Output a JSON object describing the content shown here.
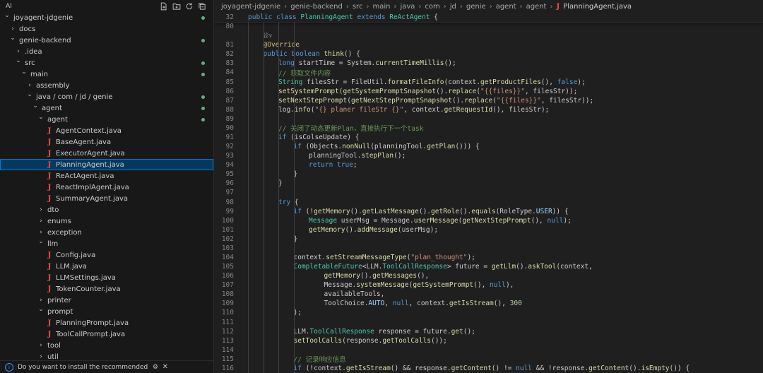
{
  "sidebar": {
    "header": "AI",
    "tree": [
      {
        "label": "joyagent-jdgenie",
        "depth": 0,
        "type": "folder",
        "open": true,
        "dot": true
      },
      {
        "label": "docs",
        "depth": 1,
        "type": "folder",
        "open": false
      },
      {
        "label": "genie-backend",
        "depth": 1,
        "type": "folder",
        "open": true,
        "dot": true
      },
      {
        "label": ".idea",
        "depth": 2,
        "type": "folder",
        "open": false
      },
      {
        "label": "src",
        "depth": 2,
        "type": "folder",
        "open": true,
        "dot": true
      },
      {
        "label": "main",
        "depth": 3,
        "type": "folder",
        "open": true,
        "dot": true
      },
      {
        "label": "assembly",
        "depth": 4,
        "type": "folder",
        "open": false
      },
      {
        "label": "java / com / jd / genie",
        "depth": 4,
        "type": "folder",
        "open": true,
        "dot": true
      },
      {
        "label": "agent",
        "depth": 5,
        "type": "folder",
        "open": true,
        "dot": true
      },
      {
        "label": "agent",
        "depth": 6,
        "type": "folder",
        "open": true,
        "dot": true
      },
      {
        "label": "AgentContext.java",
        "depth": 7,
        "type": "java"
      },
      {
        "label": "BaseAgent.java",
        "depth": 7,
        "type": "java"
      },
      {
        "label": "ExecutorAgent.java",
        "depth": 7,
        "type": "java"
      },
      {
        "label": "PlanningAgent.java",
        "depth": 7,
        "type": "java",
        "selected": true
      },
      {
        "label": "ReActAgent.java",
        "depth": 7,
        "type": "java"
      },
      {
        "label": "ReactImplAgent.java",
        "depth": 7,
        "type": "java"
      },
      {
        "label": "SummaryAgent.java",
        "depth": 7,
        "type": "java"
      },
      {
        "label": "dto",
        "depth": 6,
        "type": "folder",
        "open": false
      },
      {
        "label": "enums",
        "depth": 6,
        "type": "folder",
        "open": false
      },
      {
        "label": "exception",
        "depth": 6,
        "type": "folder",
        "open": false
      },
      {
        "label": "llm",
        "depth": 6,
        "type": "folder",
        "open": true
      },
      {
        "label": "Config.java",
        "depth": 7,
        "type": "java"
      },
      {
        "label": "LLM.java",
        "depth": 7,
        "type": "java"
      },
      {
        "label": "LLMSettings.java",
        "depth": 7,
        "type": "java"
      },
      {
        "label": "TokenCounter.java",
        "depth": 7,
        "type": "java"
      },
      {
        "label": "printer",
        "depth": 6,
        "type": "folder",
        "open": false
      },
      {
        "label": "prompt",
        "depth": 6,
        "type": "folder",
        "open": true
      },
      {
        "label": "PlanningPrompt.java",
        "depth": 7,
        "type": "java"
      },
      {
        "label": "ToolCallPrompt.java",
        "depth": 7,
        "type": "java"
      },
      {
        "label": "tool",
        "depth": 6,
        "type": "folder",
        "open": false
      },
      {
        "label": "util",
        "depth": 6,
        "type": "folder",
        "open": false
      }
    ],
    "notification": "Do you want to install the recommended"
  },
  "editor": {
    "breadcrumb": [
      "joyagent-jdgenie",
      "genie-backend",
      "src",
      "main",
      "java",
      "com",
      "jd",
      "genie",
      "agent",
      "agent"
    ],
    "file": "PlanningAgent.java",
    "sticky": {
      "num": "32",
      "html": "<span class=\"kw\">public class</span> <span class=\"cls\">PlanningAgent</span> <span class=\"kw\">extends</span> <span class=\"cls\">ReActAgent</span> {"
    },
    "lines": [
      {
        "num": "80",
        "ind": 0,
        "html": ""
      },
      {
        "num": "",
        "ind": 1,
        "html": "<span style=\"color:#8a8a8a;font-size:8px\">诊∨</span>"
      },
      {
        "num": "81",
        "ind": 1,
        "html": "<span class=\"ann\">@Override</span>"
      },
      {
        "num": "82",
        "ind": 1,
        "html": "<span class=\"kw\">public boolean</span> <span class=\"fn\">think</span>() {"
      },
      {
        "num": "83",
        "ind": 2,
        "html": "<span class=\"kw\">long</span> startTime = System.<span class=\"fn\">currentTimeMillis</span>();"
      },
      {
        "num": "84",
        "ind": 2,
        "html": "<span class=\"cmt\">// 获取文件内容</span>"
      },
      {
        "num": "85",
        "ind": 2,
        "html": "<span class=\"cls\">String</span> filesStr = FileUtil.<span class=\"fn\">formatFileInfo</span>(context.<span class=\"fn\">getProductFiles</span>(), <span class=\"kw\">false</span>);"
      },
      {
        "num": "86",
        "ind": 2,
        "html": "<span class=\"fn\">setSystemPrompt</span>(<span class=\"fn\">getSystemPromptSnapshot</span>().<span class=\"fn\">replace</span>(<span class=\"str\">\"{{files}}\"</span>, filesStr));"
      },
      {
        "num": "87",
        "ind": 2,
        "html": "<span class=\"fn\">setNextStepPrompt</span>(<span class=\"fn\">getNextStepPromptSnapshot</span>().<span class=\"fn\">replace</span>(<span class=\"str\">\"{{files}}\"</span>, filesStr));"
      },
      {
        "num": "88",
        "ind": 2,
        "html": "log.<span class=\"fn\">info</span>(<span class=\"str\">\"{} planer fileStr {}\"</span>, context.<span class=\"fn\">getRequestId</span>(), filesStr);"
      },
      {
        "num": "89",
        "ind": 0,
        "html": ""
      },
      {
        "num": "90",
        "ind": 2,
        "html": "<span class=\"cmt\">// 关闭了动态更新Plan，直接执行下一个task</span>"
      },
      {
        "num": "91",
        "ind": 2,
        "html": "<span class=\"kw\">if</span> (isColseUpdate) {"
      },
      {
        "num": "92",
        "ind": 3,
        "html": "<span class=\"kw\">if</span> (Objects.<span class=\"fn\">nonNull</span>(planningTool.<span class=\"fn\">getPlan</span>())) {"
      },
      {
        "num": "93",
        "ind": 4,
        "html": "planningTool.<span class=\"fn\">stepPlan</span>();"
      },
      {
        "num": "94",
        "ind": 4,
        "html": "<span class=\"kw\">return true</span>;"
      },
      {
        "num": "95",
        "ind": 3,
        "html": "}"
      },
      {
        "num": "96",
        "ind": 2,
        "html": "}"
      },
      {
        "num": "97",
        "ind": 0,
        "html": ""
      },
      {
        "num": "98",
        "ind": 2,
        "html": "<span class=\"kw\">try</span> {"
      },
      {
        "num": "99",
        "ind": 3,
        "html": "<span class=\"kw\">if</span> (!<span class=\"fn\">getMemory</span>().<span class=\"fn\">getLastMessage</span>().<span class=\"fn\">getRole</span>().<span class=\"fn\">equals</span>(RoleType.<span class=\"var\">USER</span>)) {"
      },
      {
        "num": "100",
        "ind": 4,
        "html": "<span class=\"cls\">Message</span> userMsg = Message.<span class=\"fn\">userMessage</span>(<span class=\"fn\">getNextStepPrompt</span>(), <span class=\"kw\">null</span>);"
      },
      {
        "num": "101",
        "ind": 4,
        "html": "<span class=\"fn\">getMemory</span>().<span class=\"fn\">addMessage</span>(userMsg);"
      },
      {
        "num": "102",
        "ind": 3,
        "html": "}"
      },
      {
        "num": "103",
        "ind": 0,
        "html": ""
      },
      {
        "num": "104",
        "ind": 3,
        "html": "context.<span class=\"fn\">setStreamMessageType</span>(<span class=\"str\">\"plan_thought\"</span>);"
      },
      {
        "num": "105",
        "ind": 3,
        "html": "<span class=\"cls\">CompletableFuture</span>&lt;LLM.<span class=\"cls\">ToolCallResponse</span>&gt; future = <span class=\"fn\">getLlm</span>().<span class=\"fn\">askTool</span>(context,"
      },
      {
        "num": "106",
        "ind": 5,
        "html": "<span class=\"fn\">getMemory</span>().<span class=\"fn\">getMessages</span>(),"
      },
      {
        "num": "107",
        "ind": 5,
        "html": "Message.<span class=\"fn\">systemMessage</span>(<span class=\"fn\">getSystemPrompt</span>(), <span class=\"kw\">null</span>),"
      },
      {
        "num": "108",
        "ind": 5,
        "html": "availableTools,"
      },
      {
        "num": "109",
        "ind": 5,
        "html": "ToolChoice.<span class=\"var\">AUTO</span>, <span class=\"kw\">null</span>, context.<span class=\"fn\">getIsStream</span>(), <span class=\"num\">300</span>"
      },
      {
        "num": "110",
        "ind": 3,
        "html": ");"
      },
      {
        "num": "111",
        "ind": 0,
        "html": ""
      },
      {
        "num": "112",
        "ind": 3,
        "html": "LLM.<span class=\"cls\">ToolCallResponse</span> response = future.<span class=\"fn\">get</span>();"
      },
      {
        "num": "113",
        "ind": 3,
        "html": "<span class=\"fn\">setToolCalls</span>(response.<span class=\"fn\">getToolCalls</span>());"
      },
      {
        "num": "114",
        "ind": 0,
        "html": ""
      },
      {
        "num": "115",
        "ind": 3,
        "html": "<span class=\"cmt\">// 记录响应信息</span>"
      },
      {
        "num": "116",
        "ind": 3,
        "html": "<span class=\"kw\">if</span> (!context.<span class=\"fn\">getIsStream</span>() &amp;&amp; response.<span class=\"fn\">getContent</span>() != <span class=\"kw\">null</span> &amp;&amp; !response.<span class=\"fn\">getContent</span>().<span class=\"fn\">isEmpty</span>()) {"
      }
    ]
  }
}
